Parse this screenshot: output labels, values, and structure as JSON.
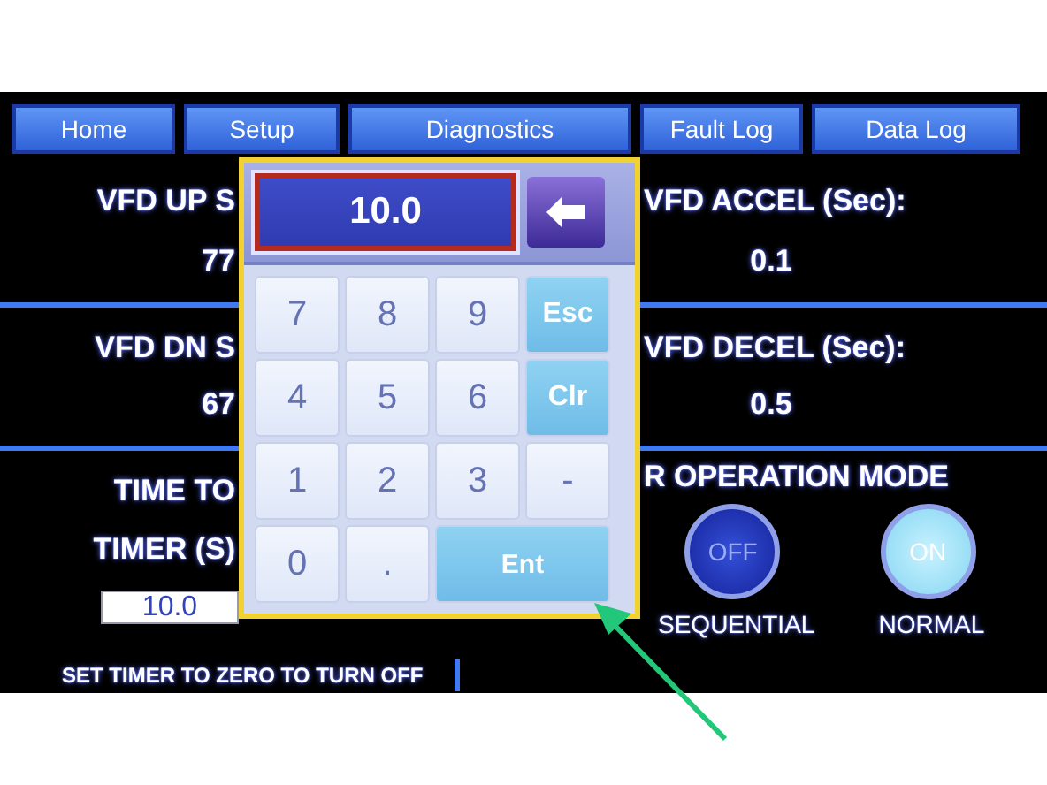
{
  "tabs": [
    {
      "label": "Home"
    },
    {
      "label": "Setup"
    },
    {
      "label": "Diagnostics"
    },
    {
      "label": "Fault Log"
    },
    {
      "label": "Data Log"
    }
  ],
  "left_panel": {
    "fields": [
      {
        "label": "VFD UP S",
        "value": "77"
      },
      {
        "label": "VFD DN S",
        "value": "67"
      }
    ],
    "timer": {
      "heading": "TIME TO",
      "label": "TIMER (S)",
      "value": "10.0"
    }
  },
  "right_panel": {
    "fields": [
      {
        "label": "VFD ACCEL (Sec):",
        "value": "0.1"
      },
      {
        "label": "VFD DECEL (Sec):",
        "value": "0.5"
      }
    ],
    "mode": {
      "heading": "R OPERATION MODE",
      "options": [
        {
          "label": "SEQUENTIAL",
          "button": "OFF",
          "on": false
        },
        {
          "label": "NORMAL",
          "button": "ON",
          "on": true
        }
      ]
    }
  },
  "footer_note": "SET TIMER TO ZERO TO TURN OFF",
  "keypad": {
    "display": "10.0",
    "keys": [
      {
        "label": "7",
        "kind": "digit"
      },
      {
        "label": "8",
        "kind": "digit"
      },
      {
        "label": "9",
        "kind": "digit"
      },
      {
        "label": "Esc",
        "kind": "function"
      },
      {
        "label": "4",
        "kind": "digit"
      },
      {
        "label": "5",
        "kind": "digit"
      },
      {
        "label": "6",
        "kind": "digit"
      },
      {
        "label": "Clr",
        "kind": "function"
      },
      {
        "label": "1",
        "kind": "digit"
      },
      {
        "label": "2",
        "kind": "digit"
      },
      {
        "label": "3",
        "kind": "digit"
      },
      {
        "label": "-",
        "kind": "digit"
      },
      {
        "label": "0",
        "kind": "digit"
      },
      {
        "label": ".",
        "kind": "digit"
      },
      {
        "label": "Ent",
        "kind": "enter"
      }
    ]
  }
}
